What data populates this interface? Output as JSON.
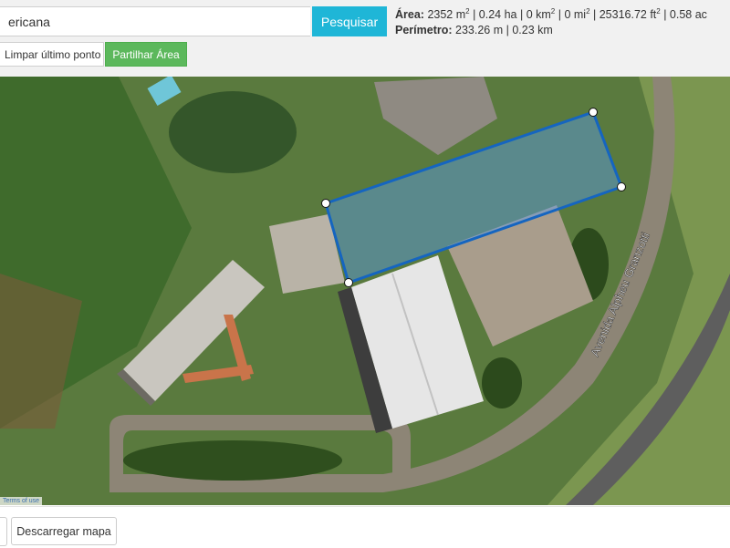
{
  "search": {
    "value": "ericana",
    "button_label": "Pesquisar"
  },
  "toolbar": {
    "undo_label": "Limpar último ponto",
    "share_label": "Partilhar Área"
  },
  "measurements": {
    "area_label": "Área:",
    "area_value_1": "2352 m",
    "area_value_2": " | 0.24 ha | 0 km",
    "area_value_3": " | 0 mi",
    "area_value_4": " | 25316.72 ft",
    "area_value_5": " | 0.58 ac",
    "sup_2": "2",
    "perimeter_label": "Perímetro:",
    "perimeter_value": "233.26 m | 0.23 km"
  },
  "map": {
    "road_label": "Avenida Alpheu Granzotti",
    "terms_label": "Terms of use",
    "polygon_color": "#1565c0",
    "fill_color": "#5b9bea"
  },
  "footer": {
    "download_label": "Descarregar mapa"
  }
}
